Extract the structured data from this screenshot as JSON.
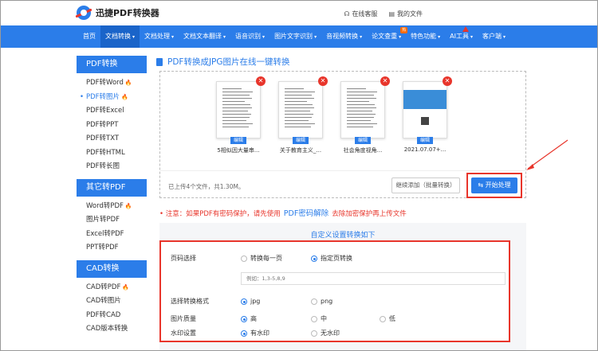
{
  "header": {
    "brand": "迅捷PDF转换器",
    "online_service": "在线客服",
    "my_files": "我的文件"
  },
  "nav": {
    "items": [
      {
        "label": "首页"
      },
      {
        "label": "文档转换",
        "caret": "▾"
      },
      {
        "label": "文档处理",
        "caret": "▾"
      },
      {
        "label": "文档文本翻译",
        "caret": "▾"
      },
      {
        "label": "语音识别",
        "caret": "▾"
      },
      {
        "label": "图片文字识别",
        "caret": "▾"
      },
      {
        "label": "音视频转换",
        "caret": "▾"
      },
      {
        "label": "论文查重",
        "caret": "▾",
        "badge": "热"
      },
      {
        "label": "特色功能",
        "caret": "▾"
      },
      {
        "label": "AI工具",
        "caret": "▾"
      },
      {
        "label": "客户端",
        "caret": "▾"
      }
    ]
  },
  "sidebar": {
    "groups": [
      {
        "title": "PDF转换",
        "items": [
          "PDF转Word",
          "PDF转图片",
          "PDF转Excel",
          "PDF转PPT",
          "PDF转TXT",
          "PDF转HTML",
          "PDF转长图"
        ]
      },
      {
        "title": "其它转PDF",
        "items": [
          "Word转PDF",
          "图片转PDF",
          "Excel转PDF",
          "PPT转PDF"
        ]
      },
      {
        "title": "CAD转换",
        "items": [
          "CAD转PDF",
          "CAD转图片",
          "PDF转CAD",
          "CAD版本转换"
        ]
      }
    ],
    "fire_icon": "🔥"
  },
  "main": {
    "title": "PDF转换成JPG图片在线一键转换",
    "files": [
      {
        "name": "5相似因大量串...",
        "edit": "编辑"
      },
      {
        "name": "关于教育主义_...",
        "edit": "编辑"
      },
      {
        "name": "社会角度视角...",
        "edit": "编辑"
      },
      {
        "name": "2021.07.07+...",
        "edit": "编辑"
      }
    ],
    "delete_glyph": "✕",
    "summary": "已上传4个文件，共1.30M。",
    "batch_button": "继续添加（批量转换）",
    "start_button": "开始处理",
    "start_icon": "⇆",
    "notice_prefix": "• 注意：如果PDF有密码保护，请先使用",
    "notice_link": "PDF密码解除",
    "notice_suffix": "去除加密保护再上传文件"
  },
  "settings": {
    "title": "自定义设置转换如下",
    "page_select_label": "页码选择",
    "page_opt_each": "转换每一页",
    "page_opt_specify": "指定页转换",
    "page_placeholder": "例如：1,3-5,8,9",
    "format_label": "选择转换格式",
    "format_jpg": "jpg",
    "format_png": "png",
    "quality_label": "图片质量",
    "quality_high": "高",
    "quality_mid": "中",
    "quality_low": "低",
    "watermark_label": "水印设置",
    "watermark_on": "有水印",
    "watermark_off": "无水印"
  },
  "colors": {
    "accent": "#2b7de9",
    "annotation_red": "#e8352b"
  }
}
